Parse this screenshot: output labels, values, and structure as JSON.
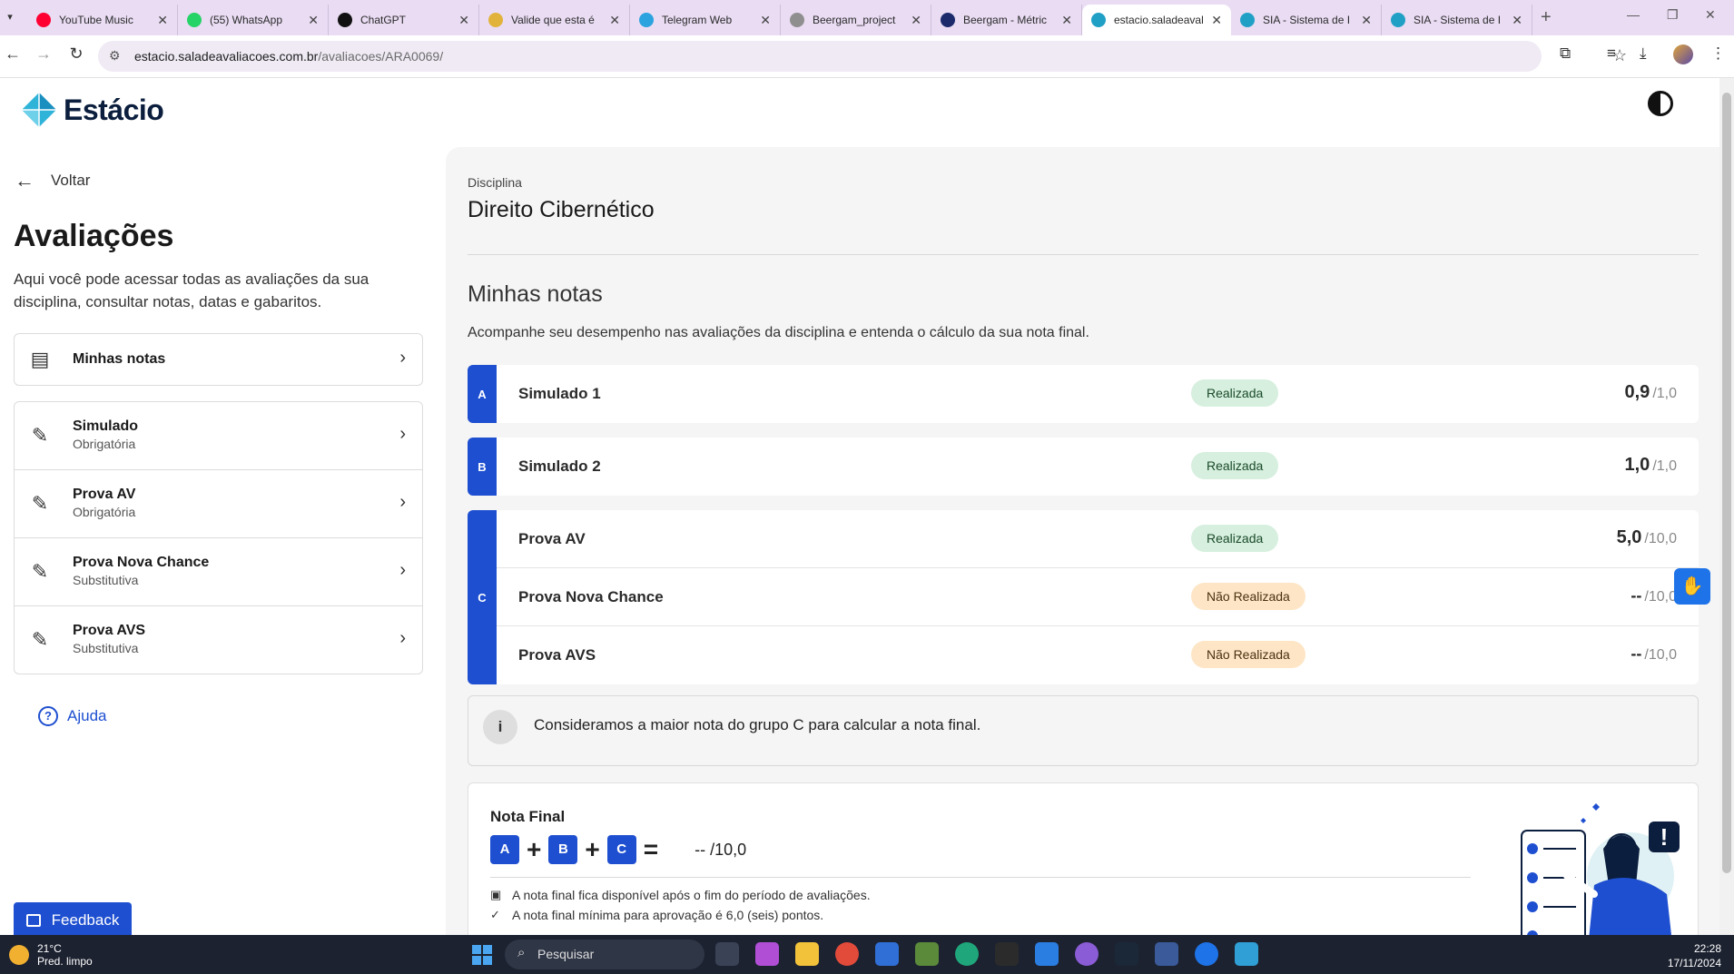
{
  "browser": {
    "tabs": [
      {
        "title": "YouTube Music",
        "color": "#ff0033"
      },
      {
        "title": "(55) WhatsApp",
        "color": "#25d366"
      },
      {
        "title": "ChatGPT",
        "color": "#111111"
      },
      {
        "title": "Valide que esta é",
        "color": "#e2b33a"
      },
      {
        "title": "Telegram Web",
        "color": "#2aa3df"
      },
      {
        "title": "Beergam_project",
        "color": "#8f8f8f"
      },
      {
        "title": "Beergam - Métric",
        "color": "#1c2a6b"
      },
      {
        "title": "estacio.saladeaval",
        "color": "#21a0c6"
      },
      {
        "title": "SIA - Sistema de I",
        "color": "#21a0c6"
      },
      {
        "title": "SIA - Sistema de I",
        "color": "#21a0c6"
      }
    ],
    "url_host": "estacio.saladeavaliacoes.com.br",
    "url_path": "/avaliacoes/ARA0069/"
  },
  "brand": {
    "name": "Estácio"
  },
  "sidebar": {
    "back_label": "Voltar",
    "title": "Avaliações",
    "description": "Aqui você pode acessar todas as avaliações da sua disciplina, consultar notas, datas e gabaritos.",
    "notes_item": "Minhas notas",
    "items": [
      {
        "title": "Simulado",
        "subtitle": "Obrigatória"
      },
      {
        "title": "Prova AV",
        "subtitle": "Obrigatória"
      },
      {
        "title": "Prova Nova Chance",
        "subtitle": "Substitutiva"
      },
      {
        "title": "Prova AVS",
        "subtitle": "Substitutiva"
      }
    ],
    "help_label": "Ajuda",
    "feedback_label": "Feedback"
  },
  "main": {
    "discipline_label": "Disciplina",
    "discipline_name": "Direito Cibernético",
    "notes_title": "Minhas notas",
    "notes_description": "Acompanhe seu desempenho nas avaliações da disciplina e entenda o cálculo da sua nota final.",
    "groups": [
      {
        "letter": "A",
        "items": [
          {
            "name": "Simulado 1",
            "status": "Realizada",
            "score": "0,9",
            "max": "/1,0"
          }
        ]
      },
      {
        "letter": "B",
        "items": [
          {
            "name": "Simulado 2",
            "status": "Realizada",
            "score": "1,0",
            "max": "/1,0"
          }
        ]
      },
      {
        "letter": "C",
        "items": [
          {
            "name": "Prova AV",
            "status": "Realizada",
            "score": "5,0",
            "max": "/10,0"
          },
          {
            "name": "Prova Nova Chance",
            "status": "Não Realizada",
            "score": "--",
            "max": "/10,0"
          },
          {
            "name": "Prova AVS",
            "status": "Não Realizada",
            "score": "--",
            "max": "/10,0"
          }
        ]
      }
    ],
    "info_text": "Consideramos a maior nota do grupo C para calcular a nota final.",
    "final": {
      "title": "Nota Final",
      "formula": [
        "A",
        "+",
        "B",
        "+",
        "C",
        "="
      ],
      "result_score": "--",
      "result_max": "/10,0",
      "note1": "A nota final fica disponível após o fim do período de avaliações.",
      "note2": "A nota final mínima para aprovação é 6,0 (seis) pontos."
    }
  },
  "taskbar": {
    "weather_temp": "21°C",
    "weather_desc": "Pred. limpo",
    "search_label": "Pesquisar",
    "time": "22:28",
    "date": "17/11/2024"
  },
  "colors": {
    "accent": "#1e4fd0",
    "status_done": "#d6efde",
    "status_pending": "#fde5c6"
  }
}
